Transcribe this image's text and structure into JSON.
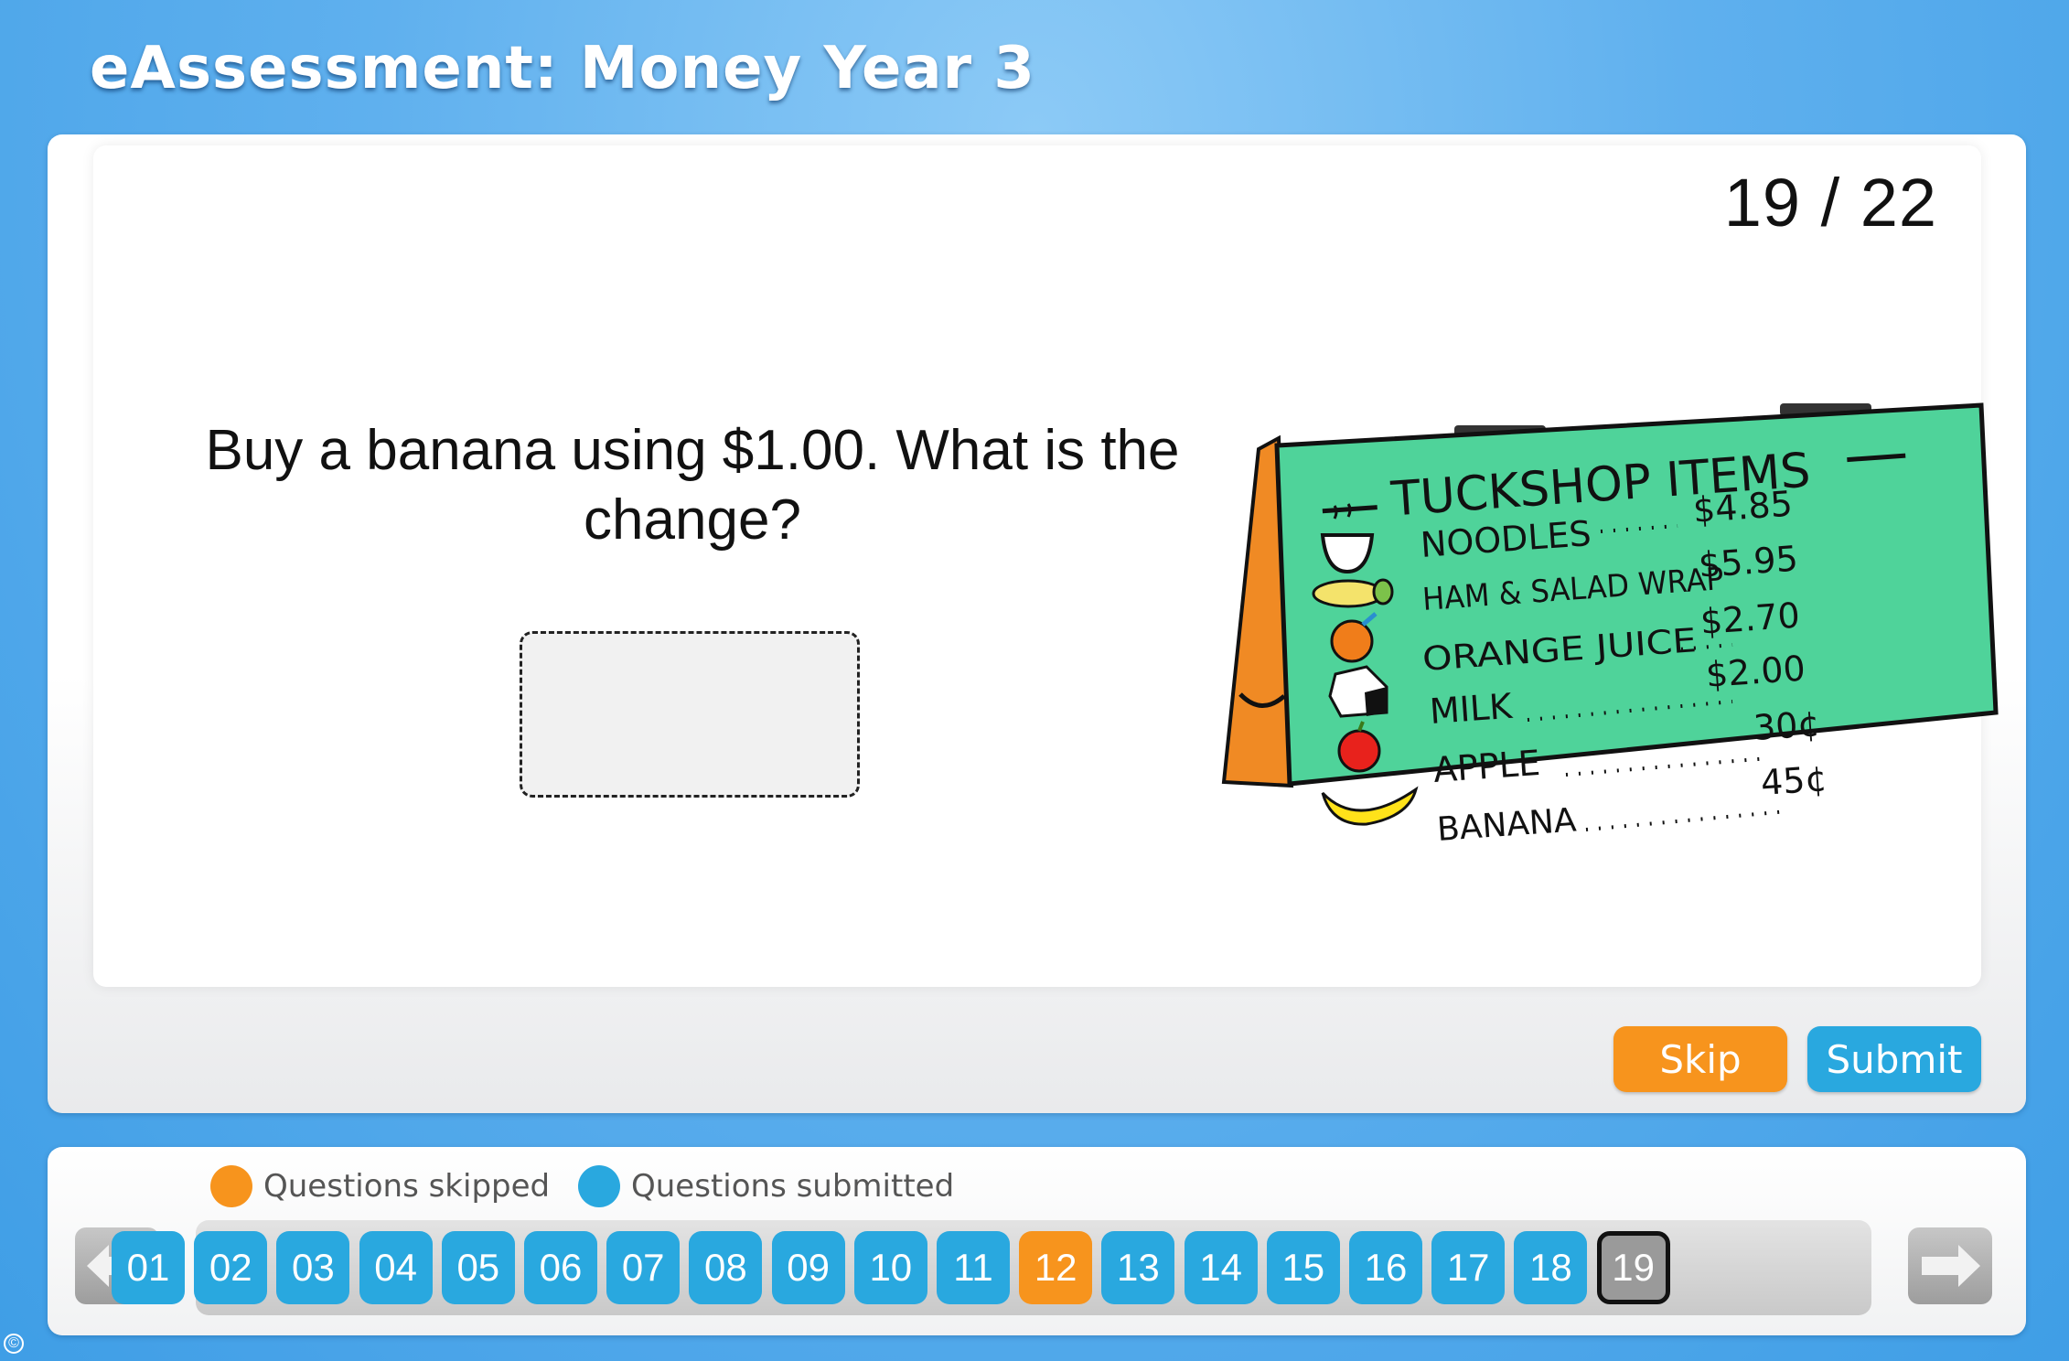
{
  "app": {
    "title": "eAssessment: Money Year 3"
  },
  "progress": {
    "current": "19",
    "separator": "/",
    "total": "22"
  },
  "question": {
    "text": "Buy a banana using $1.00. What is the change?",
    "answer_value": ""
  },
  "sign": {
    "title": "TUCKSHOP ITEMS",
    "items": [
      {
        "name": "NOODLES",
        "price": "$4.85",
        "icon": "noodles-bowl-icon"
      },
      {
        "name": "HAM & SALAD WRAP",
        "price": "$5.95",
        "icon": "wrap-icon"
      },
      {
        "name": "ORANGE JUICE",
        "price": "$2.70",
        "icon": "orange-icon"
      },
      {
        "name": "MILK",
        "price": "$2.00",
        "icon": "milk-carton-icon"
      },
      {
        "name": "APPLE",
        "price": "30¢",
        "icon": "apple-icon"
      },
      {
        "name": "BANANA",
        "price": "45¢",
        "icon": "banana-icon"
      }
    ]
  },
  "actions": {
    "skip_label": "Skip",
    "submit_label": "Submit"
  },
  "legend": {
    "skipped_label": "Questions skipped",
    "submitted_label": "Questions submitted"
  },
  "colors": {
    "skipped": "#f7941d",
    "submitted": "#29a8df",
    "current": "#9a9a9a",
    "sign_board": "#4fd39a",
    "sign_frame": "#f08a24"
  },
  "questions": [
    {
      "label": "01",
      "status": "submitted"
    },
    {
      "label": "02",
      "status": "submitted"
    },
    {
      "label": "03",
      "status": "submitted"
    },
    {
      "label": "04",
      "status": "submitted"
    },
    {
      "label": "05",
      "status": "submitted"
    },
    {
      "label": "06",
      "status": "submitted"
    },
    {
      "label": "07",
      "status": "submitted"
    },
    {
      "label": "08",
      "status": "submitted"
    },
    {
      "label": "09",
      "status": "submitted"
    },
    {
      "label": "10",
      "status": "submitted"
    },
    {
      "label": "11",
      "status": "submitted"
    },
    {
      "label": "12",
      "status": "skipped"
    },
    {
      "label": "13",
      "status": "submitted"
    },
    {
      "label": "14",
      "status": "submitted"
    },
    {
      "label": "15",
      "status": "submitted"
    },
    {
      "label": "16",
      "status": "submitted"
    },
    {
      "label": "17",
      "status": "submitted"
    },
    {
      "label": "18",
      "status": "submitted"
    },
    {
      "label": "19",
      "status": "current"
    }
  ],
  "copyright_symbol": "©"
}
